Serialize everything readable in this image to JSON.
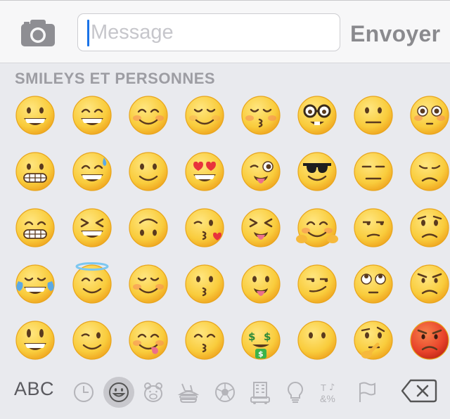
{
  "input": {
    "placeholder": "Message"
  },
  "send_label": "Envoyer",
  "category_title": "SMILEYS ET PERSONNES",
  "bottom": {
    "abc_label": "ABC",
    "tabs": [
      "clock-icon",
      "smiley-icon",
      "bear-icon",
      "food-icon",
      "ball-icon",
      "building-icon",
      "bulb-icon",
      "symbols-icon",
      "flag-icon"
    ],
    "active_tab": "smiley-icon"
  },
  "emoji_rows": [
    [
      "grinning",
      "smile",
      "blush",
      "relieved",
      "kissing-closed-eyes",
      "nerd",
      "neutral",
      "flushed"
    ],
    [
      "grimacing",
      "sweat-smile",
      "slight-smile",
      "heart-eyes",
      "winking-tongue",
      "sunglasses",
      "expressionless",
      "disappointed"
    ],
    [
      "grin-teeth",
      "laughing",
      "upside-down",
      "kissing-heart",
      "squint-tongue",
      "hugging",
      "unamused",
      "worried"
    ],
    [
      "joy",
      "innocent",
      "smiling-closed-eyes",
      "kissing",
      "tongue",
      "smirk",
      "eye-roll",
      "angry"
    ],
    [
      "smiley",
      "wink",
      "yum",
      "kissing-smiling-eyes",
      "money-mouth",
      "no-mouth",
      "thinking",
      "rage"
    ]
  ],
  "colors": {
    "face": "#f9cc3c",
    "face_edge": "#e8a51c",
    "rage": "#e8432a",
    "send": "#8a8a8e",
    "title": "#9d9da3"
  }
}
